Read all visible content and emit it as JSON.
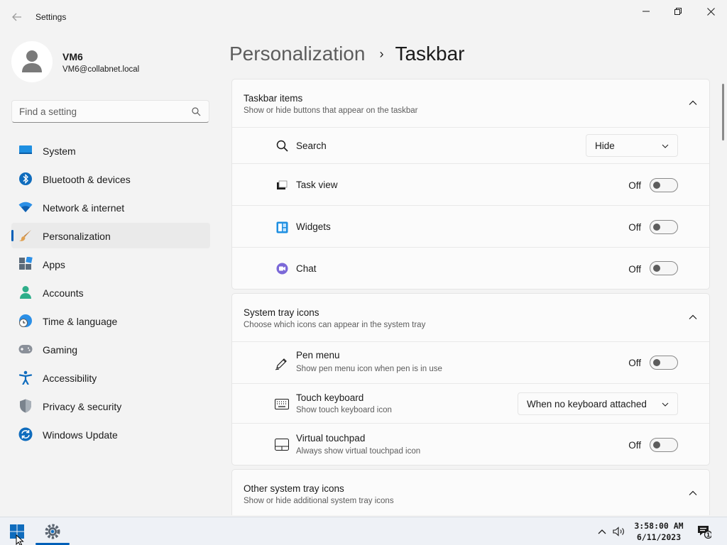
{
  "app": {
    "title": "Settings"
  },
  "user": {
    "name": "VM6",
    "email": "VM6@collabnet.local"
  },
  "search": {
    "placeholder": "Find a setting"
  },
  "nav": [
    {
      "label": "System",
      "icon": "system-icon"
    },
    {
      "label": "Bluetooth & devices",
      "icon": "bluetooth-icon"
    },
    {
      "label": "Network & internet",
      "icon": "wifi-icon"
    },
    {
      "label": "Personalization",
      "icon": "brush-icon",
      "active": true
    },
    {
      "label": "Apps",
      "icon": "apps-icon"
    },
    {
      "label": "Accounts",
      "icon": "accounts-icon"
    },
    {
      "label": "Time & language",
      "icon": "globe-clock-icon"
    },
    {
      "label": "Gaming",
      "icon": "gamepad-icon"
    },
    {
      "label": "Accessibility",
      "icon": "accessibility-icon"
    },
    {
      "label": "Privacy & security",
      "icon": "shield-icon"
    },
    {
      "label": "Windows Update",
      "icon": "update-icon"
    }
  ],
  "breadcrumb": {
    "parent": "Personalization",
    "separator": "›",
    "current": "Taskbar"
  },
  "groups": [
    {
      "title": "Taskbar items",
      "description": "Show or hide buttons that appear on the taskbar",
      "rows": [
        {
          "label": "Search",
          "icon": "search-icon",
          "control": "dropdown",
          "value": "Hide"
        },
        {
          "label": "Task view",
          "icon": "task-view-icon",
          "control": "toggle",
          "state": "Off"
        },
        {
          "label": "Widgets",
          "icon": "widgets-icon",
          "control": "toggle",
          "state": "Off"
        },
        {
          "label": "Chat",
          "icon": "chat-icon",
          "control": "toggle",
          "state": "Off"
        }
      ]
    },
    {
      "title": "System tray icons",
      "description": "Choose which icons can appear in the system tray",
      "rows": [
        {
          "label": "Pen menu",
          "sub": "Show pen menu icon when pen is in use",
          "icon": "pen-icon",
          "control": "toggle",
          "state": "Off"
        },
        {
          "label": "Touch keyboard",
          "sub": "Show touch keyboard icon",
          "icon": "keyboard-icon",
          "control": "dropdown",
          "value": "When no keyboard attached"
        },
        {
          "label": "Virtual touchpad",
          "sub": "Always show virtual touchpad icon",
          "icon": "touchpad-icon",
          "control": "toggle",
          "state": "Off"
        }
      ]
    },
    {
      "title": "Other system tray icons",
      "description": "Show or hide additional system tray icons",
      "rows": []
    }
  ],
  "taskbar": {
    "time": "3:58:00 AM",
    "date": "6/11/2023",
    "notification_count": "1"
  },
  "colors": {
    "accent": "#005fb8",
    "background": "#f3f3f3",
    "card": "#fbfbfb"
  }
}
